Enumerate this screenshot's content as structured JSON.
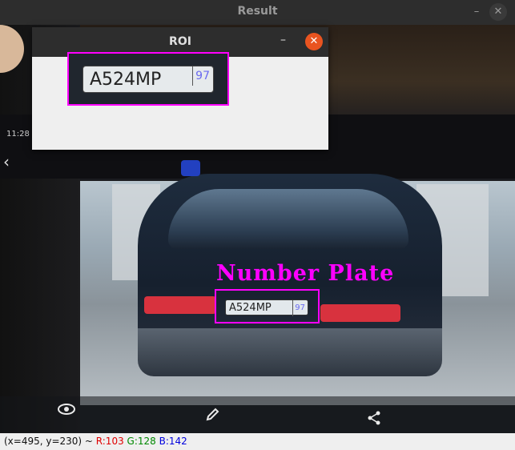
{
  "main_window": {
    "title": "Result",
    "minimize": "–",
    "close": "✕"
  },
  "photo": {
    "detection_label": "Number Plate",
    "plate_text": "А524МР",
    "plate_region": "97",
    "phone_time": "11:28",
    "nav_icons": [
      "eye-icon",
      "pencil-icon",
      "share-icon"
    ],
    "back_icon": "chevron-left-icon"
  },
  "roi_window": {
    "title": "ROI",
    "minimize": "–",
    "close": "✕",
    "plate_text": "А524МР",
    "plate_region": "97",
    "box_color": "#ff00ff"
  },
  "status_bar": {
    "coords": "(x=495, y=230) ~ ",
    "r": "R:103",
    "g": "G:128",
    "b": "B:142"
  },
  "colors": {
    "accent_close": "#e95420",
    "bbox": "#ff00ff"
  }
}
